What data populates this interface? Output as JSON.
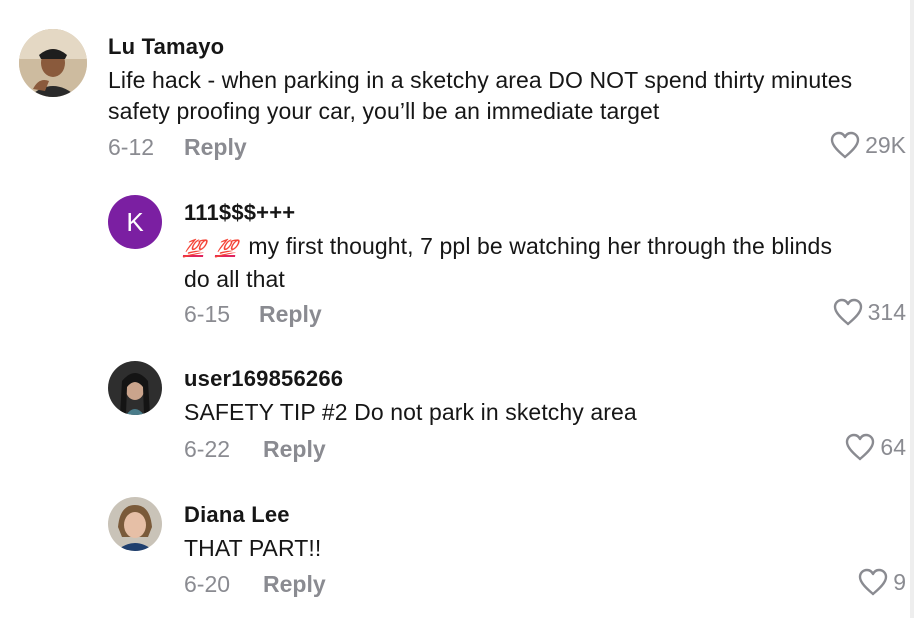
{
  "comments": [
    {
      "username": "Lu Tamayo",
      "text_lines": [
        "Life hack - when parking in a sketchy area DO NOT spend thirty minutes",
        "safety proofing your car, you’ll be an immediate target"
      ],
      "date": "6-12",
      "reply_label": "Reply",
      "likes": "29K"
    },
    {
      "username": "111$$$+++",
      "avatar_letter": "K",
      "emoji": [
        "💯",
        "💯"
      ],
      "text_lines": [
        "my first thought, 7 ppl be watching her through the blinds",
        "do all that"
      ],
      "date": "6-15",
      "reply_label": "Reply",
      "likes": "314"
    },
    {
      "username": "user169856266",
      "text_lines": [
        "SAFETY TIP #2 Do not park in sketchy area"
      ],
      "date": "6-22",
      "reply_label": "Reply",
      "likes": "64"
    },
    {
      "username": "Diana Lee",
      "text_lines": [
        "THAT PART!!"
      ],
      "date": "6-20",
      "reply_label": "Reply",
      "likes": "9"
    }
  ],
  "colors": {
    "text": "#161616",
    "meta": "#8a8b91",
    "avatar_k_bg": "#7b1fa2"
  },
  "icons": {
    "like": "heart-outline-icon"
  }
}
